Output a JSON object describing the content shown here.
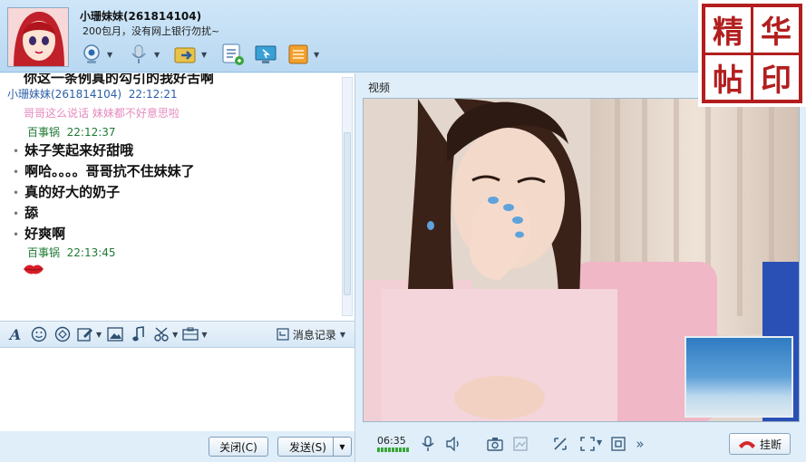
{
  "header": {
    "contact_name": "小珊妹妹(261814104)",
    "signature": "200包月，没有网上银行勿扰~"
  },
  "toolbar": {
    "icons": [
      "webcam-icon",
      "microphone-icon",
      "transfer-file-icon",
      "chat-list-icon",
      "remote-desktop-icon",
      "apps-icon"
    ]
  },
  "seal": {
    "chars": [
      "精",
      "华",
      "帖",
      "印"
    ]
  },
  "chat": {
    "truncated_line": "你这一条例真的勾引的我好舌啊",
    "messages": [
      {
        "type": "peer-header",
        "sender": "小珊妹妹(261814104)",
        "time": "22:12:21"
      },
      {
        "type": "pink",
        "text": "哥哥这么说话 妹妹都不好意思啦"
      },
      {
        "type": "self-header",
        "sender": "百事锅",
        "time": "22:12:37"
      },
      {
        "type": "line",
        "text": "妹子笑起来好甜哦"
      },
      {
        "type": "line",
        "text": "啊哈。。。。哥哥抗不住妹妹了"
      },
      {
        "type": "line",
        "text": "真的好大的奶子"
      },
      {
        "type": "line",
        "text": "舔"
      },
      {
        "type": "line",
        "text": "好爽啊"
      },
      {
        "type": "self-header",
        "sender": "百事锅",
        "time": "22:13:45"
      },
      {
        "type": "lips"
      }
    ]
  },
  "format_bar": {
    "icons": [
      "font-icon",
      "emoji-icon",
      "magic-emoji-icon",
      "edit-icon",
      "image-icon",
      "music-icon",
      "screenshot-icon",
      "more-icon"
    ],
    "history_label": "消息记录"
  },
  "buttons": {
    "close": "关闭(C)",
    "send": "发送(S)"
  },
  "video": {
    "label": "视频",
    "duration": "06:35",
    "hangup": "挂断"
  },
  "colors": {
    "self_sender": "#1f7a34",
    "peer_sender": "#2a5fa8",
    "pink_msg": "#e68abf",
    "seal_red": "#b31e1e"
  }
}
